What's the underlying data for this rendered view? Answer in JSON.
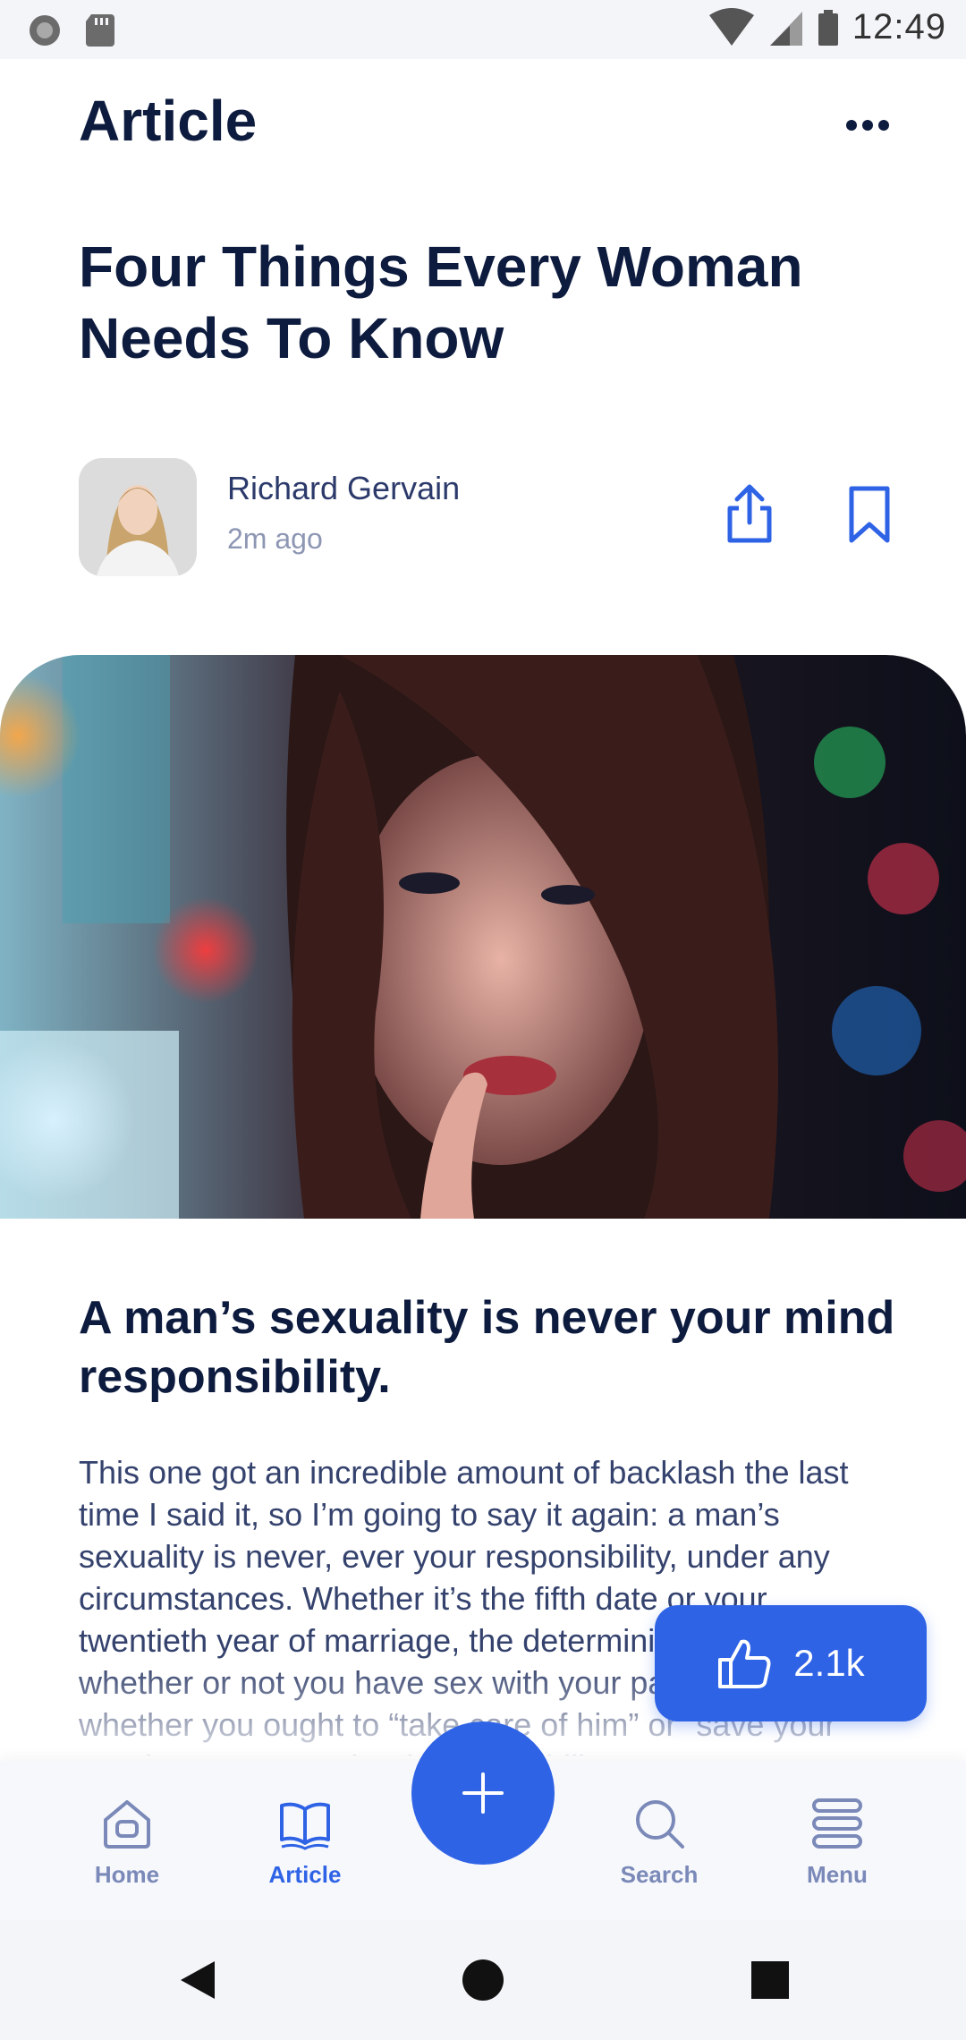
{
  "status_bar": {
    "time": "12:49"
  },
  "header": {
    "title": "Article"
  },
  "article": {
    "title": "Four Things Every Woman Needs To Know",
    "author": {
      "name": "Richard Gervain",
      "time": "2m ago"
    },
    "section_heading": "A man’s sexuality is never your mind responsibility.",
    "body": "This one got an incredible amount of backlash the last time I said it, so I’m going to say it again: a man’s sexuality is never, ever your responsibility, under any circumstances. Whether it’s the fifth date or your twentieth year of marriage, the determining factor for whether or not you have sex with your partner isn’t whether you ought to “take care of him” or “save your marriage” or any other irresponsibility."
  },
  "like": {
    "count": "2.1k"
  },
  "bottom_nav": {
    "items": [
      {
        "label": "Home",
        "icon": "home-icon"
      },
      {
        "label": "Article",
        "icon": "book-icon",
        "active": true
      },
      {
        "label": "Search",
        "icon": "search-icon"
      },
      {
        "label": "Menu",
        "icon": "menu-icon"
      }
    ],
    "fab_icon": "plus-icon"
  },
  "colors": {
    "accent": "#2f63e6",
    "title": "#0d1b3e",
    "body": "#34426d",
    "muted": "#8d96b3",
    "nav_inactive": "#7a89b8"
  }
}
